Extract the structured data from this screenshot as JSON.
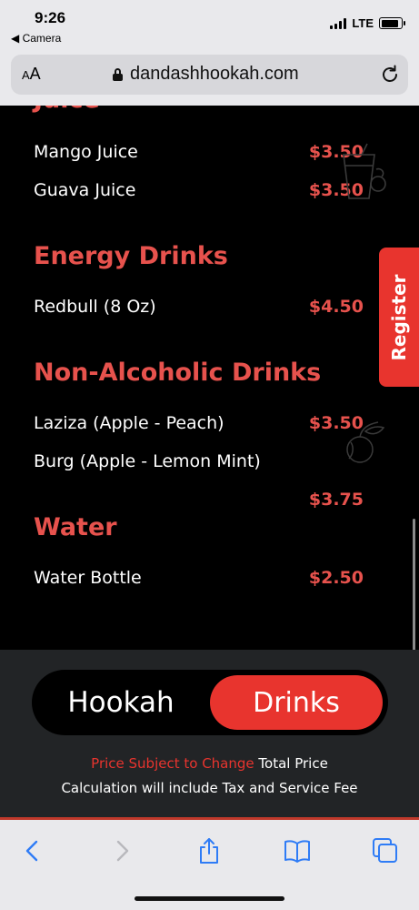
{
  "status_bar": {
    "time": "9:26",
    "back_label": "◀ Camera",
    "network": "LTE"
  },
  "browser": {
    "aa_label": "AA",
    "url": "dandashhookah.com"
  },
  "menu": {
    "sections": [
      {
        "title": "Juice",
        "items": [
          {
            "name": "Mango Juice",
            "price": "$3.50"
          },
          {
            "name": "Guava Juice",
            "price": "$3.50"
          }
        ]
      },
      {
        "title": "Energy Drinks",
        "items": [
          {
            "name": "Redbull (8 Oz)",
            "price": "$4.50"
          }
        ]
      },
      {
        "title": "Non-Alcoholic Drinks",
        "items": [
          {
            "name": "Laziza (Apple - Peach)",
            "price": "$3.50"
          },
          {
            "name": "Burg (Apple - Lemon Mint)",
            "price": "$3.75"
          }
        ]
      },
      {
        "title": "Water",
        "items": [
          {
            "name": "Water Bottle",
            "price": "$2.50"
          }
        ]
      }
    ]
  },
  "register_label": "Register",
  "toggle": {
    "hookah_label": "Hookah",
    "drinks_label": "Drinks",
    "active": "Drinks"
  },
  "note": {
    "highlight": "Price Subject to Change",
    "rest_line1": "Total Price",
    "line2": "Calculation will include Tax and Service Fee"
  },
  "colors": {
    "accent": "#e8342e",
    "heading_red": "#e7524d",
    "panel": "#222426"
  },
  "icons": {
    "toolbar": [
      "back-icon",
      "forward-icon",
      "share-icon",
      "bookmarks-icon",
      "tabs-icon"
    ]
  }
}
